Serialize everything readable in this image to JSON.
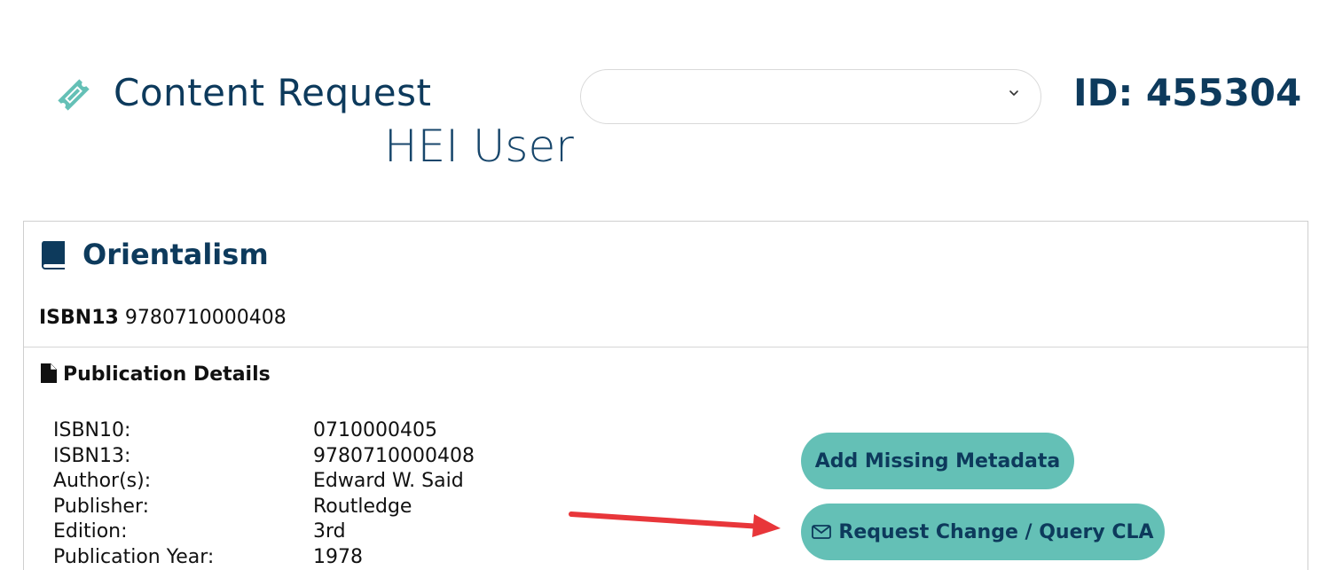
{
  "header": {
    "title": "Content Request",
    "user_role": "HEI User",
    "selector_value": "",
    "record_id": "ID: 455304",
    "icon": "ticket-icon"
  },
  "book": {
    "title": "Orientalism",
    "isbn13_label": "ISBN13",
    "isbn13_value": "9780710000408",
    "icon": "book-icon"
  },
  "publication": {
    "section_title": "Publication Details",
    "icon": "document-icon",
    "rows": [
      {
        "label": "ISBN10:",
        "value": "0710000405"
      },
      {
        "label": "ISBN13:",
        "value": "9780710000408"
      },
      {
        "label": "Author(s):",
        "value": "Edward W. Said"
      },
      {
        "label": "Publisher:",
        "value": "Routledge"
      },
      {
        "label": "Edition:",
        "value": "3rd"
      },
      {
        "label": "Publication Year:",
        "value": "1978"
      }
    ]
  },
  "actions": {
    "add_metadata_label": "Add Missing Metadata",
    "request_change_label": "Request Change / Query CLA"
  },
  "colors": {
    "brand_dark": "#0d3a5c",
    "accent_teal": "#64c0b6",
    "annotation_arrow": "#e8363a"
  }
}
